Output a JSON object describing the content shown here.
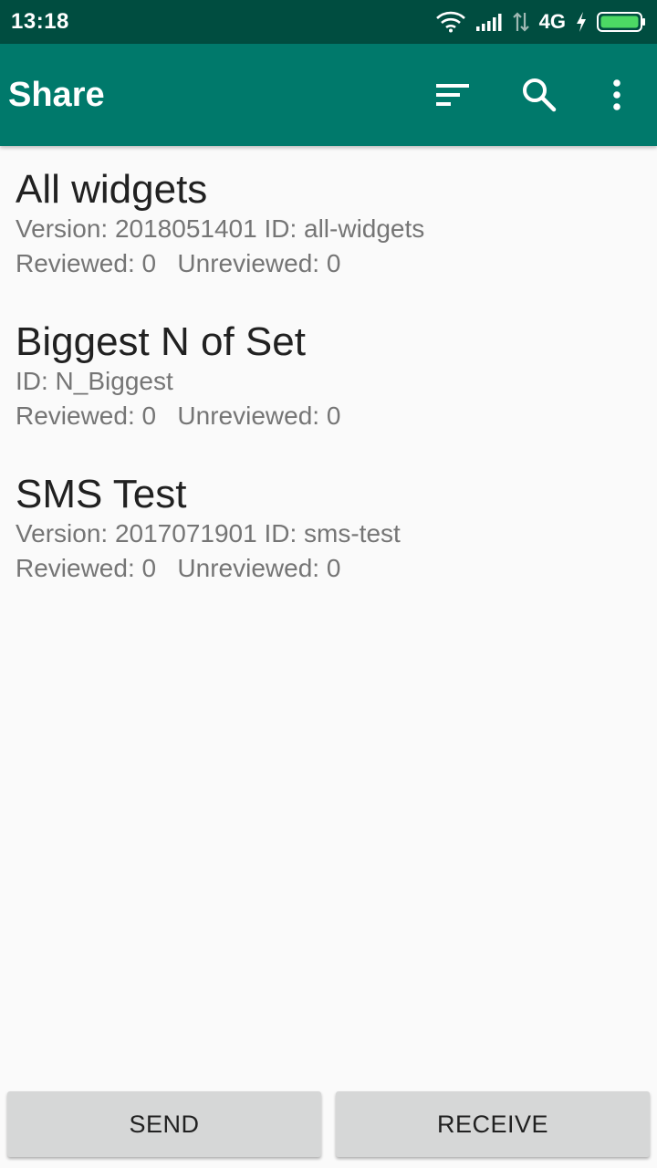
{
  "status_bar": {
    "time": "13:18",
    "network": "4G",
    "icons": [
      "wifi-icon",
      "signal-icon",
      "data-arrows-icon",
      "charging-icon",
      "battery-icon"
    ]
  },
  "app_bar": {
    "title": "Share",
    "actions": [
      "sort-icon",
      "search-icon",
      "more-vert-icon"
    ]
  },
  "forms": [
    {
      "title": "All widgets",
      "details": "Version: 2018051401 ID: all-widgets",
      "counts": "Reviewed: 0   Unreviewed: 0"
    },
    {
      "title": "Biggest N of Set",
      "details": "ID: N_Biggest",
      "counts": "Reviewed: 0   Unreviewed: 0"
    },
    {
      "title": "SMS Test",
      "details": "Version: 2017071901 ID: sms-test",
      "counts": "Reviewed: 0   Unreviewed: 0"
    }
  ],
  "buttons": {
    "send": "SEND",
    "receive": "RECEIVE"
  },
  "colors": {
    "status_bar": "#004d40",
    "app_bar": "#00796b",
    "background": "#fafafa",
    "button": "#d6d7d7",
    "battery": "#4cd964"
  }
}
